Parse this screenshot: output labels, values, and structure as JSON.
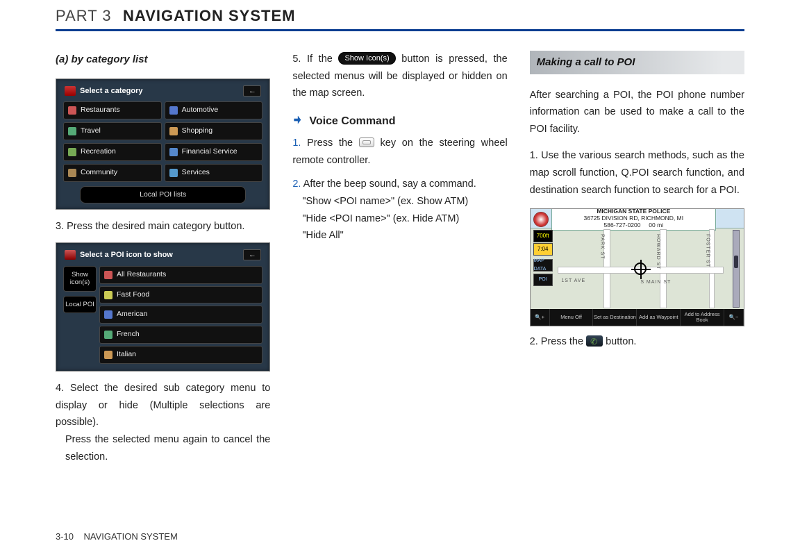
{
  "header": {
    "part": "PART 3",
    "title": "NAVIGATION SYSTEM"
  },
  "col1": {
    "subhead": "(a) by category list",
    "fig1": {
      "title": "Select a category",
      "items": [
        "Restaurants",
        "Automotive",
        "Travel",
        "Shopping",
        "Recreation",
        "Financial Service",
        "Community",
        "Services"
      ],
      "local": "Local POI lists"
    },
    "step3": "3. Press the desired main category button.",
    "fig2": {
      "title": "Select a POI icon to show",
      "side": [
        "Show icon(s)",
        "Local POI"
      ],
      "items": [
        "All Restaurants",
        "Fast Food",
        "American",
        "French",
        "Italian"
      ]
    },
    "step4": "4. Select the desired sub category menu to display or hide (Multiple selections are possible).",
    "step4b": "Press the selected menu again to cancel the selection."
  },
  "col2": {
    "step5a": "5. If the ",
    "pill": "Show Icon(s)",
    "step5b": " button is pressed, the selected menus will be displayed or hidden on the map screen.",
    "vc_head": "Voice Command",
    "vc1a": "Press the ",
    "vc1b": " key on the steering wheel remote controller.",
    "vc2": "After the beep sound, say a command.",
    "vc_lines": [
      "\"Show <POI name>\"  (ex. Show ATM)",
      "\"Hide <POI name>\"  (ex. Hide ATM)",
      "\"Hide All\""
    ]
  },
  "col3": {
    "bar": "Making a call to POI",
    "intro": "After searching a POI, the POI phone number information can be used to make a call to the POI facility.",
    "s1": "1. Use the various search methods, such as the map scroll function, Q.POI search function, and destination search function to search for a POI.",
    "map": {
      "addr1": "MICHIGAN STATE POLICE",
      "addr2": "36725 DIVISION RD, RICHMOND, MI",
      "phone": "586-727-0200",
      "dist": "00 mi",
      "scale": "700ft",
      "clock": "7:04",
      "leftbtns": [
        "MAP DATA",
        "POI"
      ],
      "bottom": [
        "🔍+",
        "Menu Off",
        "Set as Destination",
        "Add as Waypoint",
        "Add to Address Book",
        "🔍−"
      ],
      "roads": [
        "PARK ST",
        "S MAIN ST",
        "HOWARD ST",
        "FOSTER ST",
        "1ST AVE"
      ]
    },
    "s2a": "2. Press the ",
    "s2b": " button."
  },
  "footer": {
    "page": "3-10",
    "label": "NAVIGATION SYSTEM"
  }
}
